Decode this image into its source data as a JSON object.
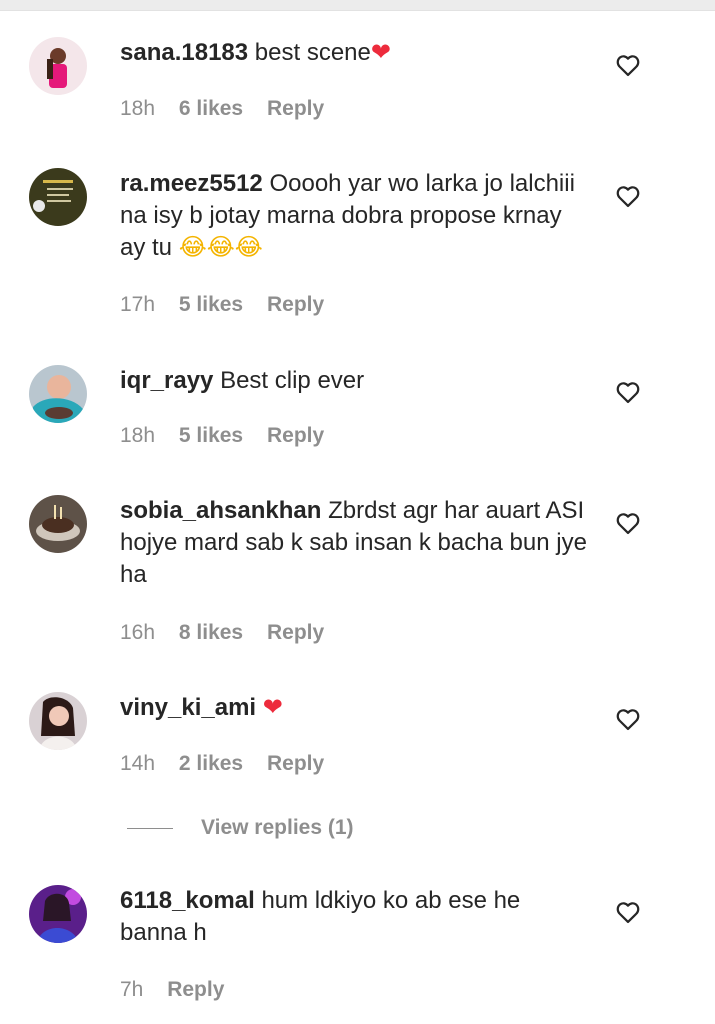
{
  "comments": [
    {
      "username": "sana.18183",
      "text": "best scene",
      "emoji": "❤",
      "time": "18h",
      "likes": "6 likes",
      "reply": "Reply"
    },
    {
      "username": "ra.meez5512",
      "text": "Ooooh yar wo larka jo lalchiii na isy b jotay marna dobra propose krnay ay tu",
      "emoji": "😂😂😂",
      "time": "17h",
      "likes": "5 likes",
      "reply": "Reply"
    },
    {
      "username": "iqr_rayy",
      "text": "Best clip ever",
      "time": "18h",
      "likes": "5 likes",
      "reply": "Reply"
    },
    {
      "username": "sobia_ahsankhan",
      "text": "Zbrdst agr har auart ASI hojye mard sab k sab insan k bacha bun jye ha",
      "time": "16h",
      "likes": "8 likes",
      "reply": "Reply"
    },
    {
      "username": "viny_ki_ami",
      "text": "",
      "emoji": "❤",
      "time": "14h",
      "likes": "2 likes",
      "reply": "Reply",
      "view_replies": "View replies (1)"
    },
    {
      "username": "6118_komal",
      "text": "hum ldkiyo ko ab ese he banna h",
      "time": "7h",
      "reply": "Reply"
    }
  ],
  "icons": {
    "like": "heart-outline-icon"
  },
  "colors": {
    "text": "#262626",
    "meta": "#8e8e8e",
    "heart_emoji": "#ed2b3c"
  }
}
